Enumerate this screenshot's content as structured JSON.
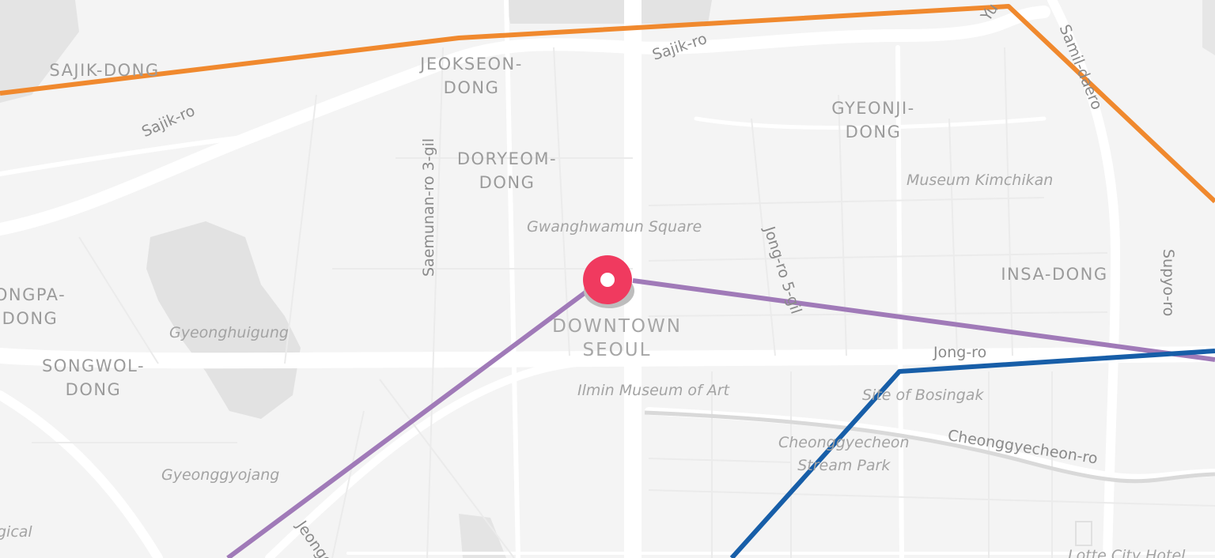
{
  "map": {
    "districts": [
      {
        "id": "sajik-dong",
        "lines": [
          "SAJIK-DONG"
        ]
      },
      {
        "id": "jeokseon-dong",
        "lines": [
          "JEOKSEON-",
          "DONG"
        ]
      },
      {
        "id": "doryeom-dong",
        "lines": [
          "DORYEOM-",
          "DONG"
        ]
      },
      {
        "id": "gyeonji-dong",
        "lines": [
          "GYEONJI-",
          "DONG"
        ]
      },
      {
        "id": "insa-dong",
        "lines": [
          "INSA-DONG"
        ]
      },
      {
        "id": "pyeongpa-dong",
        "lines": [
          "ONGPA-",
          "DONG"
        ]
      },
      {
        "id": "songwol-dong",
        "lines": [
          "SONGWOL-",
          "DONG"
        ]
      }
    ],
    "roads": [
      {
        "id": "sajik-ro-1",
        "text": "Sajik-ro"
      },
      {
        "id": "sajik-ro-2",
        "text": "Sajik-ro"
      },
      {
        "id": "saemunan-ro-3-gil",
        "text": "Saemunan-ro 3-gil"
      },
      {
        "id": "jong-ro-5-gil",
        "text": "Jong-ro 5-gil"
      },
      {
        "id": "jong-ro",
        "text": "Jong-ro"
      },
      {
        "id": "samil-daero",
        "text": "Samil-daero"
      },
      {
        "id": "supyo-ro",
        "text": "Supyo-ro"
      },
      {
        "id": "cheonggyecheon-ro",
        "text": "Cheonggyecheon-ro"
      },
      {
        "id": "jeongdong",
        "text": "Jeongd"
      },
      {
        "id": "yulgok",
        "text": "Yu"
      }
    ],
    "pois": [
      {
        "id": "gwanghwamun-square",
        "text": "Gwanghwamun Square"
      },
      {
        "id": "museum-kimchikan",
        "text": "Museum Kimchikan"
      },
      {
        "id": "ilmin-museum",
        "text": "Ilmin Museum of Art"
      },
      {
        "id": "site-of-bosingak",
        "text": "Site of Bosingak"
      },
      {
        "id": "cheonggyecheon-park",
        "lines": [
          "Cheonggyecheon",
          "Stream Park"
        ]
      },
      {
        "id": "gyeonghuigung",
        "text": "Gyeonghuigung"
      },
      {
        "id": "gyeonggyojang",
        "text": "Gyeonggyojang"
      },
      {
        "id": "lotte-city-hotel",
        "text": "Lotte City Hotel"
      },
      {
        "id": "gical",
        "text": "gical"
      }
    ],
    "marker": {
      "label_lines": [
        "DOWNTOWN",
        "SEOUL"
      ],
      "color": "#f03a5f"
    },
    "routes": [
      {
        "id": "orange-route",
        "color": "#f0892e"
      },
      {
        "id": "purple-route",
        "color": "#a07ab8"
      },
      {
        "id": "blue-route",
        "color": "#175ea8"
      }
    ]
  }
}
